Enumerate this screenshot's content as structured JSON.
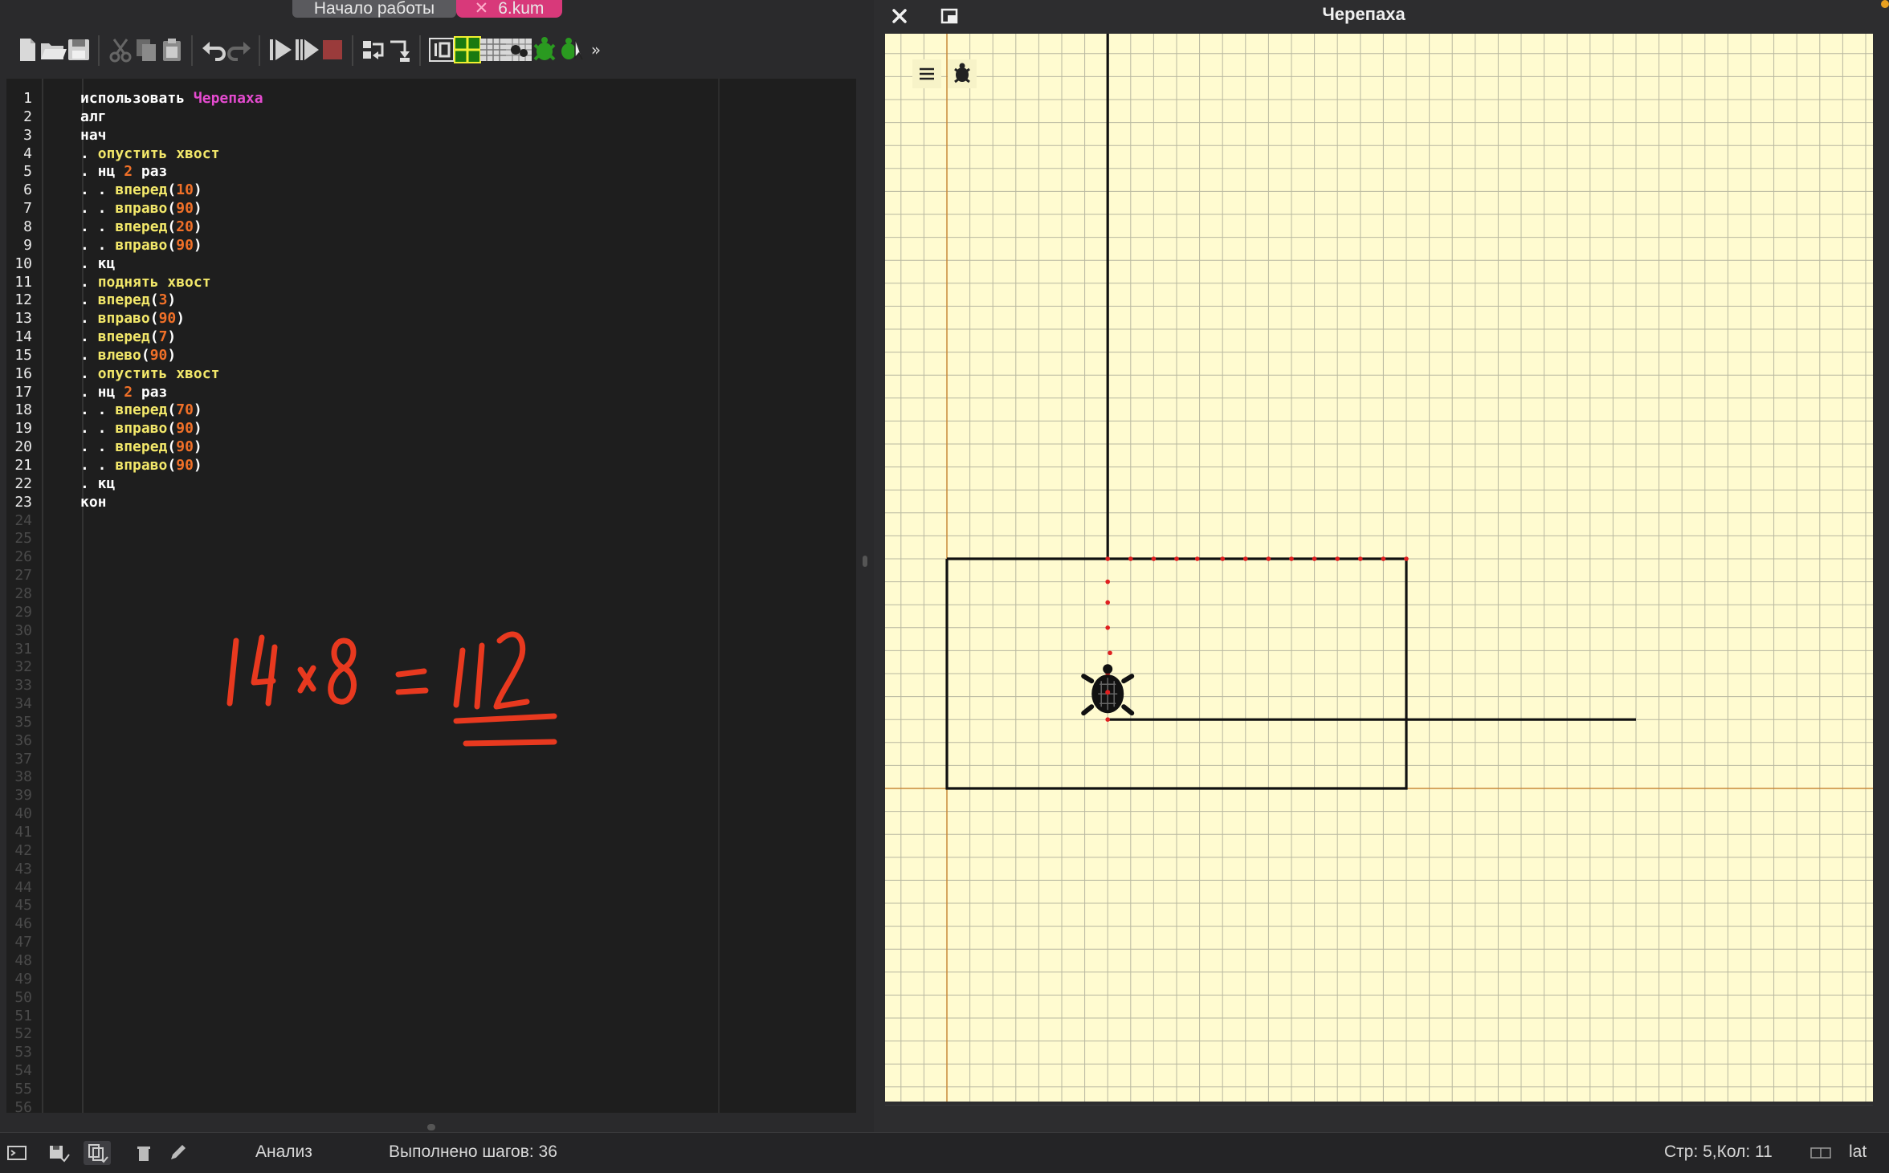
{
  "tabs": {
    "start_label": "Начало работы",
    "file_label": "6.kum",
    "file_close": "✕"
  },
  "toolbar": {
    "buttons": [
      "new-file-icon",
      "open-folder-icon",
      "save-icon",
      "cut-icon",
      "copy-icon",
      "paste-icon",
      "undo-icon",
      "redo-icon",
      "run-icon",
      "step-run-icon",
      "stop-icon",
      "step-into-icon",
      "step-out-icon",
      "robot-io-icon",
      "grid-view-icon",
      "table-view-icon",
      "image-view-icon",
      "turtle-green-icon",
      "turtle-cursor-icon"
    ],
    "more_label": "»"
  },
  "editor": {
    "lines": [
      [
        {
          "t": "использовать ",
          "c": "kw"
        },
        {
          "t": "Черепаха",
          "c": "mod"
        }
      ],
      [
        {
          "t": "алг",
          "c": "kw"
        }
      ],
      [
        {
          "t": "нач",
          "c": "kw"
        }
      ],
      [
        {
          "t": ". ",
          "c": "kw"
        },
        {
          "t": "опустить хвост",
          "c": "fn"
        }
      ],
      [
        {
          "t": ". нц ",
          "c": "kw"
        },
        {
          "t": "2",
          "c": "num"
        },
        {
          "t": " раз",
          "c": "kw"
        }
      ],
      [
        {
          "t": ". . ",
          "c": "kw"
        },
        {
          "t": "вперед",
          "c": "fn"
        },
        {
          "t": "(",
          "c": "br"
        },
        {
          "t": "10",
          "c": "num"
        },
        {
          "t": ")",
          "c": "br"
        }
      ],
      [
        {
          "t": ". . ",
          "c": "kw"
        },
        {
          "t": "вправо",
          "c": "fn"
        },
        {
          "t": "(",
          "c": "br"
        },
        {
          "t": "90",
          "c": "num"
        },
        {
          "t": ")",
          "c": "br"
        }
      ],
      [
        {
          "t": ". . ",
          "c": "kw"
        },
        {
          "t": "вперед",
          "c": "fn"
        },
        {
          "t": "(",
          "c": "br"
        },
        {
          "t": "20",
          "c": "num"
        },
        {
          "t": ")",
          "c": "br"
        }
      ],
      [
        {
          "t": ". . ",
          "c": "kw"
        },
        {
          "t": "вправо",
          "c": "fn"
        },
        {
          "t": "(",
          "c": "br"
        },
        {
          "t": "90",
          "c": "num"
        },
        {
          "t": ")",
          "c": "br"
        }
      ],
      [
        {
          "t": ". кц",
          "c": "kw"
        }
      ],
      [
        {
          "t": ". ",
          "c": "kw"
        },
        {
          "t": "поднять хвост",
          "c": "fn"
        }
      ],
      [
        {
          "t": ". ",
          "c": "kw"
        },
        {
          "t": "вперед",
          "c": "fn"
        },
        {
          "t": "(",
          "c": "br"
        },
        {
          "t": "3",
          "c": "num"
        },
        {
          "t": ")",
          "c": "br"
        }
      ],
      [
        {
          "t": ". ",
          "c": "kw"
        },
        {
          "t": "вправо",
          "c": "fn"
        },
        {
          "t": "(",
          "c": "br"
        },
        {
          "t": "90",
          "c": "num"
        },
        {
          "t": ")",
          "c": "br"
        }
      ],
      [
        {
          "t": ". ",
          "c": "kw"
        },
        {
          "t": "вперед",
          "c": "fn"
        },
        {
          "t": "(",
          "c": "br"
        },
        {
          "t": "7",
          "c": "num"
        },
        {
          "t": ")",
          "c": "br"
        }
      ],
      [
        {
          "t": ". ",
          "c": "kw"
        },
        {
          "t": "влево",
          "c": "fn"
        },
        {
          "t": "(",
          "c": "br"
        },
        {
          "t": "90",
          "c": "num"
        },
        {
          "t": ")",
          "c": "br"
        }
      ],
      [
        {
          "t": ". ",
          "c": "kw"
        },
        {
          "t": "опустить хвост",
          "c": "fn"
        }
      ],
      [
        {
          "t": ". нц ",
          "c": "kw"
        },
        {
          "t": "2",
          "c": "num"
        },
        {
          "t": " раз",
          "c": "kw"
        }
      ],
      [
        {
          "t": ". . ",
          "c": "kw"
        },
        {
          "t": "вперед",
          "c": "fn"
        },
        {
          "t": "(",
          "c": "br"
        },
        {
          "t": "70",
          "c": "num"
        },
        {
          "t": ")",
          "c": "br"
        }
      ],
      [
        {
          "t": ". . ",
          "c": "kw"
        },
        {
          "t": "вправо",
          "c": "fn"
        },
        {
          "t": "(",
          "c": "br"
        },
        {
          "t": "90",
          "c": "num"
        },
        {
          "t": ")",
          "c": "br"
        }
      ],
      [
        {
          "t": ". . ",
          "c": "kw"
        },
        {
          "t": "вперед",
          "c": "fn"
        },
        {
          "t": "(",
          "c": "br"
        },
        {
          "t": "90",
          "c": "num"
        },
        {
          "t": ")",
          "c": "br"
        }
      ],
      [
        {
          "t": ". . ",
          "c": "kw"
        },
        {
          "t": "вправо",
          "c": "fn"
        },
        {
          "t": "(",
          "c": "br"
        },
        {
          "t": "90",
          "c": "num"
        },
        {
          "t": ")",
          "c": "br"
        }
      ],
      [
        {
          "t": ". кц",
          "c": "kw"
        }
      ],
      [
        {
          "t": "кон",
          "c": "kw"
        }
      ]
    ],
    "total_line_numbers": 56,
    "handwritten_note": "14×8 = 112"
  },
  "turtle_panel": {
    "title": "Черепаха",
    "close_icon": "close-icon",
    "float_icon": "float-window-icon",
    "menu_icon": "hamburger-menu-icon",
    "turtle_button_icon": "turtle-icon"
  },
  "status": {
    "mode_label": "Анализ",
    "steps_label": "Выполнено шагов: 36",
    "cursor_label": "Стр: 5,Кол: 11",
    "keyboard_label": "lat"
  },
  "colors": {
    "accent_tab": "#d8397a",
    "canvas_bg": "#fffbd0",
    "code_function": "#f3e86a",
    "code_number": "#f07028",
    "code_module": "#e54bd0",
    "handwriting": "#e8391f"
  }
}
